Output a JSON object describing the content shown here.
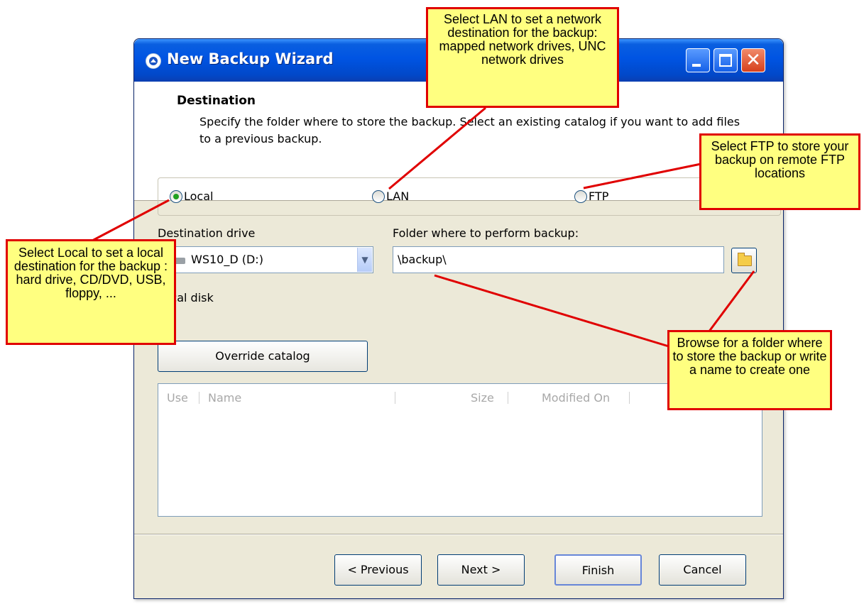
{
  "window": {
    "title": "New Backup Wizard",
    "controls": {
      "minimize": "minimize-icon",
      "maximize": "maximize-icon",
      "close": "close-icon",
      "close_glyph": "✕"
    }
  },
  "header": {
    "title": "Destination",
    "description": "Specify the folder where to store the backup. Select an existing catalog if you want to add files to a previous backup."
  },
  "destination_type": {
    "options": [
      {
        "label": "Local",
        "selected": true
      },
      {
        "label": "LAN",
        "selected": false
      },
      {
        "label": "FTP",
        "selected": false
      }
    ]
  },
  "drive": {
    "label": "Destination drive",
    "value": "WS10_D (D:)",
    "icon": "drive-icon",
    "arrow": "▼",
    "info": "Local disk"
  },
  "folder": {
    "label": "Folder where to perform backup:",
    "value": "\\backup\\",
    "browse_icon": "folder-icon"
  },
  "override_button": "Override catalog",
  "catalog_table": {
    "columns": [
      "Use",
      "Name",
      "Size",
      "Modified On"
    ],
    "rows": []
  },
  "buttons": {
    "previous": "< Previous",
    "next": "Next >",
    "finish": "Finish",
    "cancel": "Cancel"
  },
  "callouts": {
    "lan": "Select LAN to set a network destination for the backup: mapped network drives, UNC network drives",
    "ftp": "Select FTP to store your backup on remote FTP locations",
    "local": "Select Local to set a local destination for the backup : hard drive, CD/DVD, USB, floppy, ...",
    "browse": "Browse for a folder where to store the backup or write a name to create one"
  },
  "colors": {
    "callout_fill": "#ffff80",
    "callout_border": "#e00000",
    "titlebar": "#0054e3",
    "window_face": "#ece9d8"
  }
}
